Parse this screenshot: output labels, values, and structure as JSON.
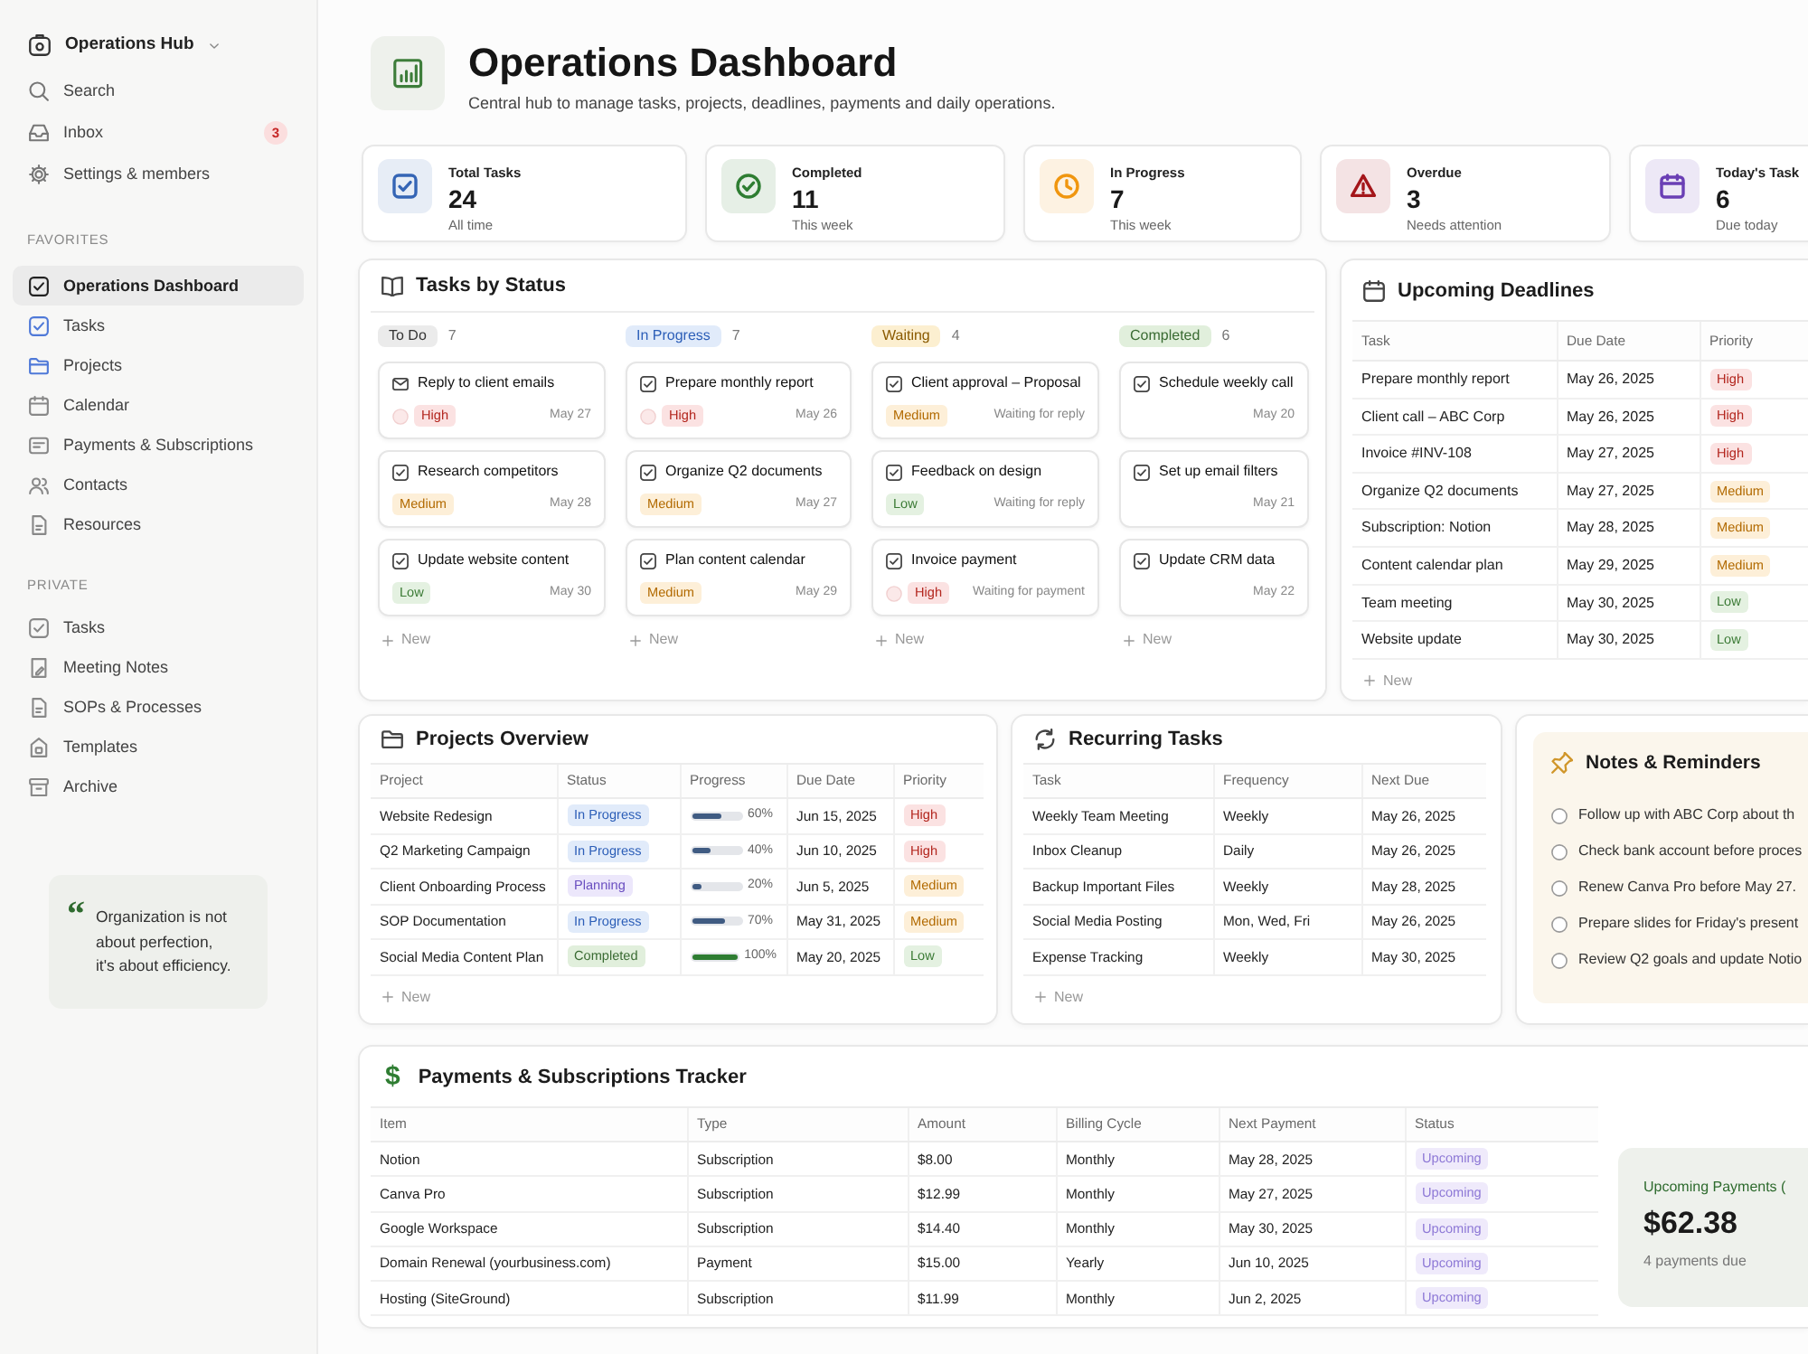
{
  "sidebar": {
    "workspace": "Operations Hub",
    "top_items": [
      {
        "label": "Search"
      },
      {
        "label": "Inbox",
        "badge": "3"
      },
      {
        "label": "Settings & members"
      }
    ],
    "sections": [
      {
        "title": "FAVORITES",
        "items": [
          {
            "label": "Operations Dashboard",
            "selected": true
          },
          {
            "label": "Tasks",
            "selected": false
          },
          {
            "label": "Projects",
            "selected": false
          },
          {
            "label": "Calendar",
            "selected": false
          },
          {
            "label": "Payments & Subscriptions",
            "selected": false
          },
          {
            "label": "Contacts",
            "selected": false
          },
          {
            "label": "Resources",
            "selected": false
          }
        ]
      },
      {
        "title": "PRIVATE",
        "items": [
          {
            "label": "Tasks",
            "selected": false
          },
          {
            "label": "Meeting Notes",
            "selected": false
          },
          {
            "label": "SOPs & Processes",
            "selected": false
          },
          {
            "label": "Templates",
            "selected": false
          },
          {
            "label": "Archive",
            "selected": false
          }
        ]
      }
    ],
    "quote": {
      "mark": "“",
      "text": "Organization is not\nabout perfection,\nit's about efficiency."
    }
  },
  "header": {
    "title": "Operations Dashboard",
    "subtitle": "Central hub to manage tasks, projects, deadlines, payments and daily operations."
  },
  "stats": [
    {
      "label": "Total Tasks",
      "value": "24",
      "note": "All time",
      "color": "#3565b5"
    },
    {
      "label": "Completed",
      "value": "11",
      "note": "This week",
      "color": "#2e7d32"
    },
    {
      "label": "In Progress",
      "value": "7",
      "note": "This week",
      "color": "#f0960f"
    },
    {
      "label": "Overdue",
      "value": "3",
      "note": "Needs attention",
      "color": "#a4161a"
    },
    {
      "label": "Today's Task",
      "value": "6",
      "note": "Due today",
      "color": "#6a3fb5"
    }
  ],
  "tasks_by_status": {
    "title": "Tasks by Status",
    "columns": [
      {
        "label": "To Do",
        "kind": "todo",
        "count": "7",
        "cards": [
          {
            "kind": "email",
            "title": "Reply to client emails",
            "priority": {
              "label": "High",
              "kind": "high"
            },
            "date": "May 27"
          },
          {
            "kind": "task",
            "title": "Research competitors",
            "priority": {
              "label": "Medium",
              "kind": "medium"
            },
            "date": "May 28"
          },
          {
            "kind": "task",
            "title": "Update website content",
            "priority": {
              "label": "Low",
              "kind": "low"
            },
            "date": "May 30"
          }
        ],
        "new_label": "New"
      },
      {
        "label": "In Progress",
        "kind": "progress",
        "count": "7",
        "cards": [
          {
            "kind": "task",
            "title": "Prepare monthly report",
            "priority": {
              "label": "High",
              "kind": "high"
            },
            "date": "May 26"
          },
          {
            "kind": "task",
            "title": "Organize Q2 documents",
            "priority": {
              "label": "Medium",
              "kind": "medium"
            },
            "date": "May 27"
          },
          {
            "kind": "task",
            "title": "Plan content calendar",
            "priority": {
              "label": "Medium",
              "kind": "medium"
            },
            "date": "May 29"
          }
        ],
        "new_label": "New"
      },
      {
        "label": "Waiting",
        "kind": "waiting",
        "count": "4",
        "cards": [
          {
            "kind": "task",
            "title": "Client approval – Proposal",
            "priority": {
              "label": "Medium",
              "kind": "medium"
            },
            "note": "Waiting for reply"
          },
          {
            "kind": "task",
            "title": "Feedback on design",
            "priority": {
              "label": "Low",
              "kind": "low"
            },
            "note": "Waiting for reply"
          },
          {
            "kind": "task",
            "title": "Invoice payment",
            "priority": {
              "label": "High",
              "kind": "high"
            },
            "note": "Waiting for payment"
          }
        ],
        "new_label": "New"
      },
      {
        "label": "Completed",
        "kind": "done",
        "count": "6",
        "cards": [
          {
            "kind": "task",
            "title": "Schedule weekly call",
            "date": "May 20"
          },
          {
            "kind": "task",
            "title": "Set up email filters",
            "date": "May 21"
          },
          {
            "kind": "task",
            "title": "Update CRM data",
            "date": "May 22"
          }
        ],
        "new_label": "New"
      }
    ]
  },
  "upcoming_deadlines": {
    "title": "Upcoming Deadlines",
    "columns": [
      "Task",
      "Due Date",
      "Priority"
    ],
    "rows": [
      {
        "task": "Prepare monthly report",
        "due": "May 26, 2025",
        "priority": {
          "label": "High",
          "kind": "high"
        }
      },
      {
        "task": "Client call – ABC Corp",
        "due": "May 26, 2025",
        "priority": {
          "label": "High",
          "kind": "high"
        }
      },
      {
        "task": "Invoice #INV-108",
        "due": "May 27, 2025",
        "priority": {
          "label": "High",
          "kind": "high"
        }
      },
      {
        "task": "Organize Q2 documents",
        "due": "May 27, 2025",
        "priority": {
          "label": "Medium",
          "kind": "medium"
        }
      },
      {
        "task": "Subscription: Notion",
        "due": "May 28, 2025",
        "priority": {
          "label": "Medium",
          "kind": "medium"
        }
      },
      {
        "task": "Content calendar plan",
        "due": "May 29, 2025",
        "priority": {
          "label": "Medium",
          "kind": "medium"
        }
      },
      {
        "task": "Team meeting",
        "due": "May 30, 2025",
        "priority": {
          "label": "Low",
          "kind": "low"
        }
      },
      {
        "task": "Website update",
        "due": "May 30, 2025",
        "priority": {
          "label": "Low",
          "kind": "low"
        }
      }
    ],
    "new_label": "New"
  },
  "projects": {
    "title": "Projects Overview",
    "columns": [
      "Project",
      "Status",
      "Progress",
      "Due Date",
      "Priority"
    ],
    "rows": [
      {
        "project": "Website Redesign",
        "status": {
          "label": "In Progress",
          "kind": "progress"
        },
        "level": 0.6,
        "percent": "60%",
        "due": "Jun 15, 2025",
        "priority": {
          "label": "High",
          "kind": "high"
        }
      },
      {
        "project": "Q2 Marketing Campaign",
        "status": {
          "label": "In Progress",
          "kind": "progress"
        },
        "level": 0.4,
        "percent": "40%",
        "due": "Jun 10, 2025",
        "priority": {
          "label": "High",
          "kind": "high"
        }
      },
      {
        "project": "Client Onboarding Process",
        "status": {
          "label": "Planning",
          "kind": "planning"
        },
        "level": 0.2,
        "percent": "20%",
        "due": "Jun 5, 2025",
        "priority": {
          "label": "Medium",
          "kind": "medium"
        }
      },
      {
        "project": "SOP Documentation",
        "status": {
          "label": "In Progress",
          "kind": "progress"
        },
        "level": 0.7,
        "percent": "70%",
        "due": "May 31, 2025",
        "priority": {
          "label": "Medium",
          "kind": "medium"
        }
      },
      {
        "project": "Social Media Content Plan",
        "status": {
          "label": "Completed",
          "kind": "done"
        },
        "level": 1,
        "percent": "100%",
        "due": "May 20, 2025",
        "priority": {
          "label": "Low",
          "kind": "low"
        }
      }
    ],
    "new_label": "New"
  },
  "recurring_tasks": {
    "title": "Recurring Tasks",
    "columns": [
      "Task",
      "Frequency",
      "Next Due"
    ],
    "rows": [
      {
        "task": "Weekly Team Meeting",
        "frequency": "Weekly",
        "next_due": "May 26, 2025"
      },
      {
        "task": "Inbox Cleanup",
        "frequency": "Daily",
        "next_due": "May 26, 2025"
      },
      {
        "task": "Backup Important Files",
        "frequency": "Weekly",
        "next_due": "May 28, 2025"
      },
      {
        "task": "Social Media Posting",
        "frequency": "Mon, Wed, Fri",
        "next_due": "May 26, 2025"
      },
      {
        "task": "Expense Tracking",
        "frequency": "Weekly",
        "next_due": "May 30, 2025"
      }
    ],
    "new_label": "New"
  },
  "notes": {
    "title": "Notes & Reminders",
    "items": [
      {
        "text": "Follow up with ABC Corp about th",
        "checked": false
      },
      {
        "text": "Check bank account before proces",
        "checked": false
      },
      {
        "text": "Renew Canva Pro before May 27.",
        "checked": false
      },
      {
        "text": "Prepare slides for Friday's present",
        "checked": false
      },
      {
        "text": "Review Q2 goals and update Notio",
        "checked": false
      }
    ]
  },
  "payments": {
    "icon": "$",
    "title": "Payments & Subscriptions Tracker",
    "columns": [
      "Item",
      "Type",
      "Amount",
      "Billing Cycle",
      "Next Payment",
      "Status"
    ],
    "rows": [
      {
        "item": "Notion",
        "type": "Subscription",
        "amount": "$8.00",
        "cycle": "Monthly",
        "next": "May 28, 2025",
        "status": {
          "label": "Upcoming",
          "kind": "upcoming"
        }
      },
      {
        "item": "Canva Pro",
        "type": "Subscription",
        "amount": "$12.99",
        "cycle": "Monthly",
        "next": "May 27, 2025",
        "status": {
          "label": "Upcoming",
          "kind": "upcoming"
        }
      },
      {
        "item": "Google Workspace",
        "type": "Subscription",
        "amount": "$14.40",
        "cycle": "Monthly",
        "next": "May 30, 2025",
        "status": {
          "label": "Upcoming",
          "kind": "upcoming"
        }
      },
      {
        "item": "Domain Renewal (yourbusiness.com)",
        "type": "Payment",
        "amount": "$15.00",
        "cycle": "Yearly",
        "next": "Jun 10, 2025",
        "status": {
          "label": "Upcoming",
          "kind": "upcoming"
        }
      },
      {
        "item": "Hosting (SiteGround)",
        "type": "Subscription",
        "amount": "$11.99",
        "cycle": "Monthly",
        "next": "Jun 2, 2025",
        "status": {
          "label": "Upcoming",
          "kind": "upcoming"
        }
      }
    ],
    "summary": {
      "title": "Upcoming Payments (",
      "amount": "$62.38",
      "note": "4 payments due"
    }
  }
}
